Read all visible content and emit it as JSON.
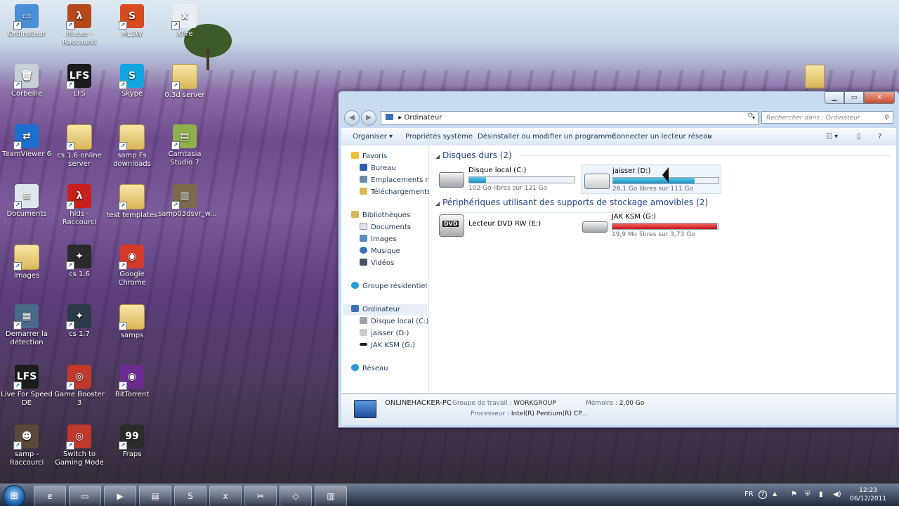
{
  "desktop": {
    "icons": [
      {
        "label": "Ordinateur",
        "glyph": "▭",
        "color": "#4a8fd6"
      },
      {
        "label": "hl.exe - Raccourci",
        "glyph": "λ",
        "color": "#b6481c"
      },
      {
        "label": "HLSW",
        "glyph": "S",
        "color": "#d94a1e"
      },
      {
        "label": "Xfire",
        "glyph": "x",
        "color": "#e8eef4"
      },
      {
        "label": "Corbeille",
        "glyph": "🗑",
        "color": "#c8d0d8"
      },
      {
        "label": "LFS",
        "glyph": "LFS",
        "color": "#1c1c1c"
      },
      {
        "label": "Skype",
        "glyph": "S",
        "color": "#12a5e0"
      },
      {
        "label": "0.3d server",
        "glyph": "",
        "color": "folder"
      },
      {
        "label": "TeamViewer 6",
        "glyph": "⇄",
        "color": "#1a6fcf"
      },
      {
        "label": "cs 1.6 online server",
        "glyph": "",
        "color": "folder"
      },
      {
        "label": "samp Fs downloads",
        "glyph": "",
        "color": "folder"
      },
      {
        "label": "Camtasia Studio 7",
        "glyph": "▤",
        "color": "#8fb04a"
      },
      {
        "label": "Documents",
        "glyph": "≡",
        "color": "#dfe6ee"
      },
      {
        "label": "hlds - Raccourci",
        "glyph": "λ",
        "color": "#c8201c"
      },
      {
        "label": "test templates",
        "glyph": "",
        "color": "folder"
      },
      {
        "label": "samp03dsvr_w...",
        "glyph": "▥",
        "color": "#7a6a4a"
      },
      {
        "label": "images",
        "glyph": "",
        "color": "folder"
      },
      {
        "label": "cs 1.6",
        "glyph": "✦",
        "color": "#2a2a2a"
      },
      {
        "label": "Google Chrome",
        "glyph": "◉",
        "color": "#d43a2a"
      },
      {
        "label": "Demarrer la détection",
        "glyph": "▦",
        "color": "#4a6a8a"
      },
      {
        "label": "cs 1.7",
        "glyph": "✦",
        "color": "#2a3a4a"
      },
      {
        "label": "samps",
        "glyph": "",
        "color": "folder"
      },
      {
        "label": "Live For Speed DE",
        "glyph": "LFS",
        "color": "#1c1c1c"
      },
      {
        "label": "Game Booster 3",
        "glyph": "◎",
        "color": "#c0392b"
      },
      {
        "label": "BitTorrent",
        "glyph": "◉",
        "color": "#6a2c91"
      },
      {
        "label": "samp - Raccourci",
        "glyph": "☻",
        "color": "#5a4a3a"
      },
      {
        "label": "Switch to Gaming Mode",
        "glyph": "◎",
        "color": "#c0392b"
      },
      {
        "label": "Fraps",
        "glyph": "99",
        "color": "#2b2b2b"
      }
    ],
    "right_folder": {
      "label": ""
    }
  },
  "window": {
    "address_root_icon": "computer-icon",
    "breadcrumb": "Ordinateur",
    "search_placeholder": "Rechercher dans : Ordinateur",
    "commands": [
      "Organiser ▾",
      "Propriétés système",
      "Désinstaller ou modifier un programme",
      "Connecter un lecteur réseau",
      "»"
    ],
    "nav": {
      "favorites": "Favoris",
      "favorite_items": [
        "Bureau",
        "Emplacements récents",
        "Téléchargements"
      ],
      "libraries": "Bibliothèques",
      "library_items": [
        "Documents",
        "Images",
        "Musique",
        "Vidéos"
      ],
      "homegroup": "Groupe résidentiel",
      "computer": "Ordinateur",
      "computer_items": [
        "Disque local (C:)",
        "jaisser (D:)",
        "JAK KSM (G:)"
      ],
      "network": "Réseau"
    },
    "groups": {
      "hard_drives": "Disques durs (2)",
      "removable": "Périphériques utilisant des supports de stockage amovibles (2)"
    },
    "drives": [
      {
        "name": "Disque local (C:)",
        "info": "102 Go libres sur 121 Go",
        "used_fraction": 0.16,
        "color": "blue"
      },
      {
        "name": "jaisser (D:)",
        "info": "26,1 Go libres sur 111 Go",
        "used_fraction": 0.77,
        "color": "blue"
      },
      {
        "name": "Lecteur DVD RW (E:)",
        "info": "",
        "used_fraction": null,
        "color": "none"
      },
      {
        "name": "JAK KSM (G:)",
        "info": "19,9 Mo libres sur 3,73 Go",
        "used_fraction": 0.995,
        "color": "red"
      }
    ],
    "details": {
      "computer_name": "ONLINEHACKER-PC",
      "workgroup_label": "Groupe de travail :",
      "workgroup_value": "WORKGROUP",
      "memory_label": "Mémoire :",
      "memory_value": "2,00 Go",
      "processor_label": "Processeur :",
      "processor_value": "Intel(R) Pentium(R) CP..."
    }
  },
  "taskbar": {
    "items": [
      "e",
      "▭",
      "▶",
      "▤",
      "S",
      "x",
      "✂",
      "◇",
      "▥"
    ],
    "language": "FR",
    "time": "12:23",
    "date": "06/12/2011"
  }
}
